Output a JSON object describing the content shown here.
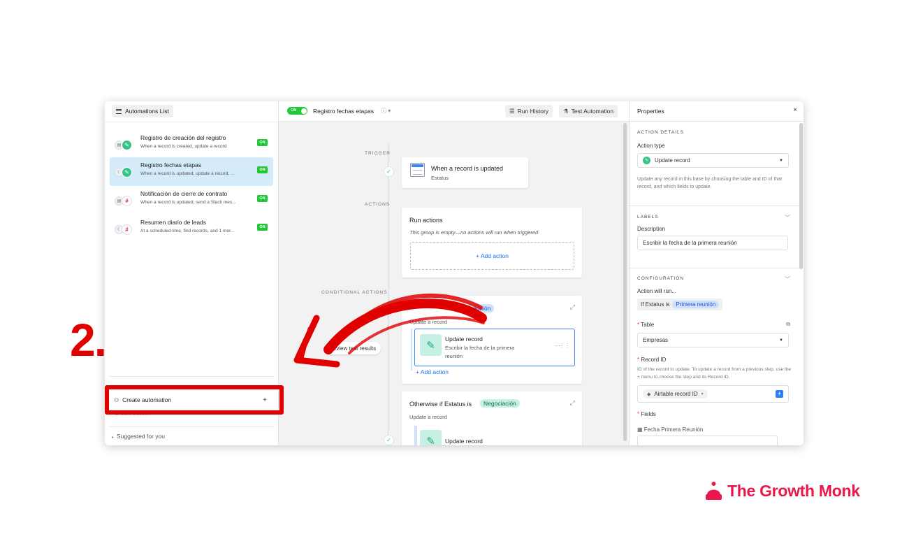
{
  "left": {
    "list_button": "Automations List",
    "automations": [
      {
        "title": "Registro de creación del registro",
        "subtitle": "When a record is created, update a record",
        "status": "ON"
      },
      {
        "title": "Registro fechas etapas",
        "subtitle": "When a record is updated, update a record, ...",
        "status": "ON"
      },
      {
        "title": "Notificación de cierre de contrato",
        "subtitle": "When a record is updated, send a Slack mes...",
        "status": "ON"
      },
      {
        "title": "Resumen diario de leads",
        "subtitle": "At a scheduled time, find records, and 1 mor...",
        "status": "ON"
      }
    ],
    "create_automation": "Create automation",
    "create_plus": "+",
    "create_section": "Create section",
    "suggested": "Suggested for you"
  },
  "center": {
    "toggle": "ON",
    "automation_name": "Registro fechas etapas",
    "run_history": "Run History",
    "test_automation": "Test Automation",
    "trigger_label": "TRIGGER",
    "trigger_title": "When a record is updated",
    "trigger_sub": "Estatus",
    "actions_label": "ACTIONS",
    "run_actions_title": "Run actions",
    "run_actions_sub": "This group is empty—no actions will run when triggered",
    "add_action": "+ Add action",
    "conditional_label": "CONDITIONAL ACTIONS",
    "cond1_pill": "reunión",
    "cond1_sub": "Update a record",
    "update_title": "Update record",
    "update_desc_1": "Escribir la fecha de la primera",
    "update_desc_2": "reunión",
    "add_action_2": "+ Add action",
    "review": "Review test results",
    "cond2_prefix": "Otherwise if Estatus is",
    "cond2_pill": "Negociación",
    "cond2_sub": "Update a record",
    "cond2_update_title": "Update record"
  },
  "right": {
    "title": "Properties",
    "close": "×",
    "action_details": "ACTION DETAILS",
    "action_type_label": "Action type",
    "action_type_value": "Update record",
    "action_help": "Update any record in this base by choosing the table and ID of that record, and which fields to update.",
    "labels": "LABELS",
    "description_label": "Description",
    "description_value": "Escribir la fecha de la primera reunión",
    "configuration": "CONFIGURATION",
    "will_run": "Action will run...",
    "cond_prefix": "If Estatus is",
    "cond_pill": "Primera reunión",
    "table_label": "Table",
    "table_value": "Empresas",
    "record_id_label": "Record ID",
    "record_id_help": "ID of the record to update. To update a record from a previous step, use the + menu to choose the step and its Record ID.",
    "record_id_value": "Airtable record ID",
    "fields_label": "Fields",
    "field_name": "Fecha Primera Reunión"
  },
  "overlay": {
    "step_number": "2.",
    "brand": "The Growth Monk"
  },
  "colors": {
    "accent_red": "#e00000",
    "brand_pink": "#e8174e",
    "on_green": "#20c933",
    "selection_blue": "#3b82f6"
  }
}
